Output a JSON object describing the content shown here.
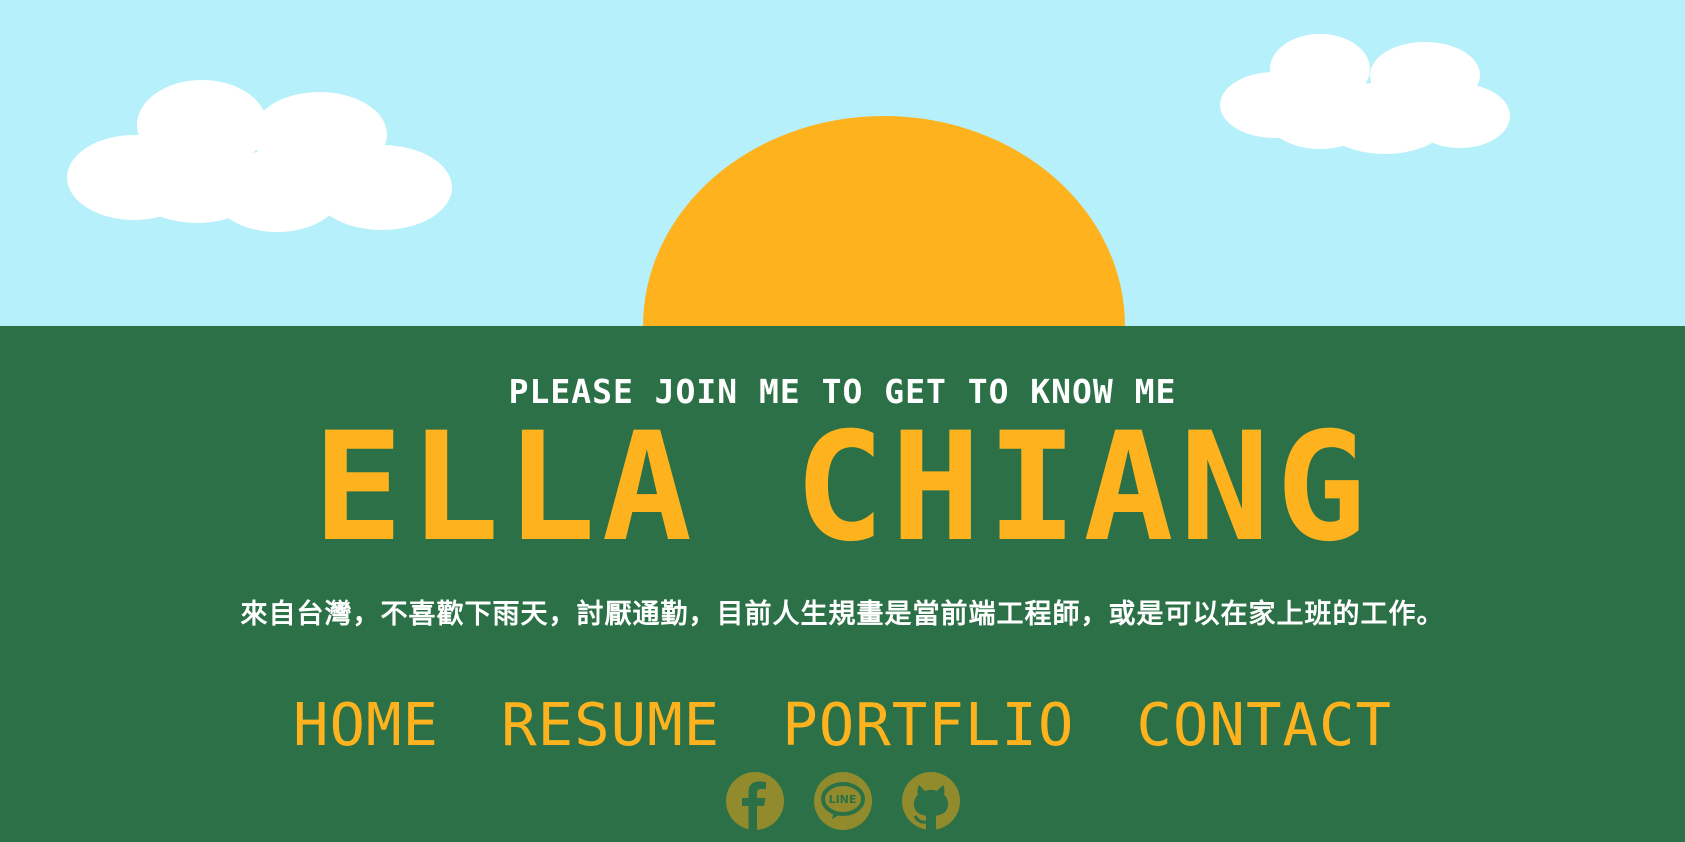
{
  "hero": {
    "tagline": "PLEASE JOIN ME TO GET TO KNOW ME",
    "name": "ELLA CHIANG",
    "intro": "來自台灣，不喜歡下雨天，討厭通勤，目前人生規畫是當前端工程師，或是可以在家上班的工作。"
  },
  "nav": {
    "items": [
      {
        "label": "HOME"
      },
      {
        "label": "RESUME"
      },
      {
        "label": "PORTFLIO"
      },
      {
        "label": "CONTACT"
      }
    ]
  },
  "social": {
    "icons": [
      "facebook-icon",
      "line-icon",
      "github-icon"
    ],
    "line_text": "LINE"
  },
  "colors": {
    "sky": "#b6f1fb",
    "sun": "#feb31e",
    "ground": "#2b7046",
    "accent": "#feb31e",
    "icon": "#928b2e"
  }
}
